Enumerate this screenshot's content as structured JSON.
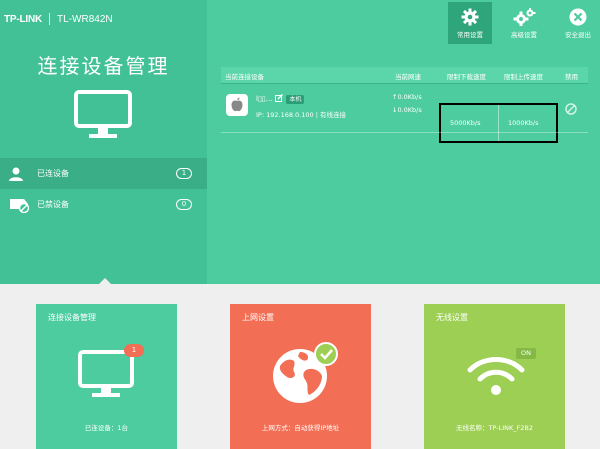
{
  "brand": {
    "logo": "TP-LINK",
    "model": "TL-WR842N"
  },
  "sidebar": {
    "title": "连接设备管理",
    "items": [
      {
        "label": "已连设备",
        "count": "1"
      },
      {
        "label": "已禁设备",
        "count": "0"
      }
    ]
  },
  "toolbar": {
    "common": "常用设置",
    "advanced": "高级设置",
    "exit": "安全退出"
  },
  "device_table": {
    "headers": {
      "device": "当前连接设备",
      "speed": "当前网速",
      "limit_down": "限制下载速度",
      "limit_up": "限制上传速度",
      "ban": "禁用"
    },
    "row": {
      "name": "l▯▯...",
      "badge": "本机",
      "ip": "IP: 192.168.0.100 | 有线连接",
      "speed_up": "↑0.0Kb/s",
      "speed_down": "↓0.0Kb/s",
      "limit_down": "5000Kb/s",
      "limit_up": "1000Kb/s"
    }
  },
  "cards": {
    "devices": {
      "title": "连接设备管理",
      "badge": "1",
      "footer": "已连设备：1台"
    },
    "internet": {
      "title": "上网设置",
      "footer": "上网方式：自动获得IP地址"
    },
    "wireless": {
      "title": "无线设置",
      "badge": "ON",
      "footer": "无线名称：TP-LINK_F2B2"
    }
  },
  "colors": {
    "primary": "#4dcca0",
    "sidebar": "#43c196",
    "internet": "#f26e54",
    "wireless": "#9ccf54",
    "alert": "#f26e54"
  }
}
